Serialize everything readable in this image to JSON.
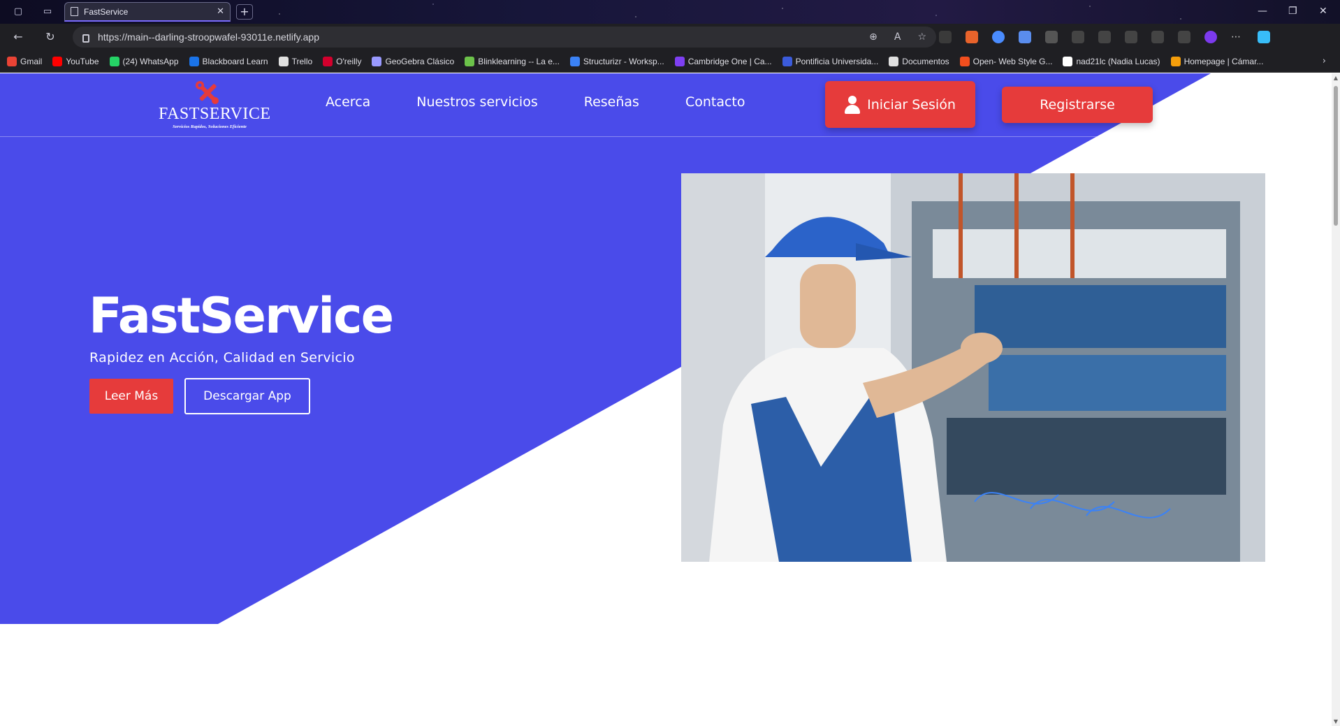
{
  "browser": {
    "tab_title": "FastService",
    "url": "https://main--darling-stroopwafel-93011e.netlify.app",
    "bookmarks": [
      {
        "label": "Gmail",
        "icon": "gmail-icon",
        "color": "#ea4335"
      },
      {
        "label": "YouTube",
        "icon": "youtube-icon",
        "color": "#ff0000"
      },
      {
        "label": "(24) WhatsApp",
        "icon": "whatsapp-icon",
        "color": "#25d366"
      },
      {
        "label": "Blackboard Learn",
        "icon": "blackboard-icon",
        "color": "#1a73e8"
      },
      {
        "label": "Trello",
        "icon": "trello-icon",
        "color": "#e0e0e0"
      },
      {
        "label": "O'reilly",
        "icon": "oreilly-icon",
        "color": "#d3002d"
      },
      {
        "label": "GeoGebra Clásico",
        "icon": "geogebra-icon",
        "color": "#9999ff"
      },
      {
        "label": "Blinklearning -- La e...",
        "icon": "blinklearning-icon",
        "color": "#6cc24a"
      },
      {
        "label": "Structurizr - Worksp...",
        "icon": "structurizr-icon",
        "color": "#3b82f6"
      },
      {
        "label": "Cambridge One | Ca...",
        "icon": "cambridge-icon",
        "color": "#7e3ff2"
      },
      {
        "label": "Pontificia Universida...",
        "icon": "university-icon",
        "color": "#3b5bdb"
      },
      {
        "label": "Documentos",
        "icon": "documents-icon",
        "color": "#e0e0e0"
      },
      {
        "label": "Open- Web Style G...",
        "icon": "figma-icon",
        "color": "#f24e1e"
      },
      {
        "label": "nad21lc (Nadia Lucas)",
        "icon": "github-icon",
        "color": "#ffffff"
      },
      {
        "label": "Homepage | Cámar...",
        "icon": "homepage-icon",
        "color": "#f59e0b"
      }
    ]
  },
  "colors": {
    "primary": "#4a4bea",
    "accent": "#e63b3b",
    "text_light": "#ffffff"
  },
  "site": {
    "logo": {
      "wordmark": "FASTSERVICE",
      "tagline": "Servicios Rapidos, Soluciones Eficiente"
    },
    "nav": [
      "Acerca",
      "Nuestros servicios",
      "Reseñas",
      "Contacto"
    ],
    "login_label": "Iniciar Sesión",
    "register_label": "Registrarse"
  },
  "hero": {
    "title": "FastService",
    "subtitle": "Rapidez en Acción, Calidad en Servicio",
    "read_more_label": "Leer Más",
    "download_label": "Descargar App",
    "image_alt": "electrician-working-on-panel"
  }
}
